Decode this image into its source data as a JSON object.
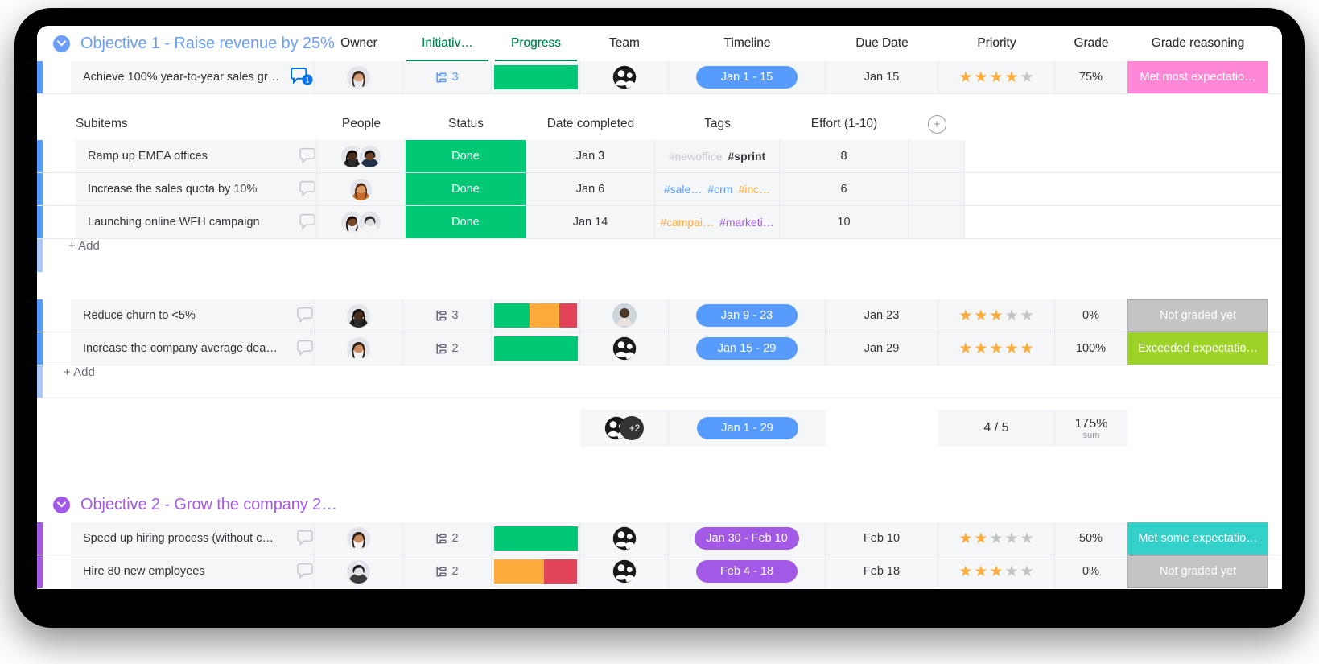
{
  "groups": [
    {
      "id": "objective-1",
      "title": "Objective 1 - Raise revenue by 25%",
      "color": "#6c9ef8",
      "columns": [
        "Owner",
        "Initiativ…",
        "Progress",
        "Team",
        "Timeline",
        "Due Date",
        "Priority",
        "Grade",
        "Grade reasoning"
      ],
      "items": [
        {
          "name": "Achieve 100% year-to-year sales gr…",
          "updates": "1",
          "initiatives": "3",
          "progress": [
            {
              "color": "#00c875",
              "pct": 100
            }
          ],
          "timeline": "Jan 1 - 15",
          "timeline_color": "#579bfc",
          "due_date": "Jan 15",
          "priority": 4,
          "grade": "75%",
          "grade_reason": "Met most expectatio…",
          "grade_reason_color": "#ff87d8"
        },
        {
          "name": "Reduce churn to <5%",
          "initiatives": "3",
          "progress": [
            {
              "color": "#00c875",
              "pct": 43
            },
            {
              "color": "#fdab3d",
              "pct": 35
            },
            {
              "color": "#e2445c",
              "pct": 22
            }
          ],
          "timeline": "Jan 9 - 23",
          "timeline_color": "#579bfc",
          "due_date": "Jan 23",
          "priority": 3,
          "grade": "0%",
          "grade_reason": "Not graded yet",
          "grade_reason_color": "#c4c4c4"
        },
        {
          "name": "Increase the company average dea…",
          "initiatives": "2",
          "progress": [
            {
              "color": "#00c875",
              "pct": 100
            }
          ],
          "timeline": "Jan 15 - 29",
          "timeline_color": "#579bfc",
          "due_date": "Jan 29",
          "priority": 5,
          "grade": "100%",
          "grade_reason": "Exceeded expectatio…",
          "grade_reason_color": "#9cd326"
        }
      ],
      "add_label": "+ Add",
      "summary": {
        "team_extra": "+2",
        "timeline": "Jan 1 - 29",
        "timeline_color": "#579bfc",
        "priority": "4 / 5",
        "grade": "175%",
        "grade_caption": "sum"
      }
    },
    {
      "id": "objective-2",
      "title": "Objective 2 - Grow the company 2…",
      "color": "#a259e6",
      "columns": [
        "Owner",
        "Initiativ…",
        "Progress",
        "Team",
        "Timeline",
        "Due Date",
        "Priority",
        "Grade",
        "Grade reasoning"
      ],
      "items": [
        {
          "name": "Speed up hiring process (without c…",
          "initiatives": "2",
          "progress": [
            {
              "color": "#00c875",
              "pct": 100
            }
          ],
          "timeline": "Jan 30 - Feb 10",
          "timeline_color": "#a259e6",
          "due_date": "Feb 10",
          "priority": 2,
          "grade": "50%",
          "grade_reason": "Met some expectatio…",
          "grade_reason_color": "#33d1c9"
        },
        {
          "name": "Hire 80 new employees",
          "initiatives": "2",
          "progress": [
            {
              "color": "#fdab3d",
              "pct": 60
            },
            {
              "color": "#e2445c",
              "pct": 40
            }
          ],
          "timeline": "Feb 4 - 18",
          "timeline_color": "#a259e6",
          "due_date": "Feb 18",
          "priority": 3,
          "grade": "0%",
          "grade_reason": "Not graded yet",
          "grade_reason_color": "#c4c4c4"
        }
      ]
    }
  ],
  "subboard": {
    "columns": [
      "Subitems",
      "People",
      "Status",
      "Date completed",
      "Tags",
      "Effort (1-10)"
    ],
    "add_column_icon": "plus-icon",
    "rows": [
      {
        "name": "Ramp up EMEA offices",
        "status": "Done",
        "status_color": "#00c875",
        "date_completed": "Jan 3",
        "tags": [
          {
            "text": "#newoffice",
            "color": "#c5c7d0"
          },
          {
            "text": "#sprint",
            "color": "#323338",
            "bold": true
          }
        ],
        "effort": "8"
      },
      {
        "name": "Increase the sales quota by 10%",
        "status": "Done",
        "status_color": "#00c875",
        "date_completed": "Jan 6",
        "tags": [
          {
            "text": "#sale…",
            "color": "#579bfc"
          },
          {
            "text": "#crm",
            "color": "#579bfc"
          },
          {
            "text": "#inc…",
            "color": "#fdab3d"
          }
        ],
        "effort": "6"
      },
      {
        "name": "Launching online WFH campaign",
        "status": "Done",
        "status_color": "#00c875",
        "date_completed": "Jan 14",
        "tags": [
          {
            "text": "#campai…",
            "color": "#fdab3d"
          },
          {
            "text": "#marketi…",
            "color": "#a259e6"
          }
        ],
        "effort": "10"
      }
    ],
    "add_label": "+ Add"
  }
}
